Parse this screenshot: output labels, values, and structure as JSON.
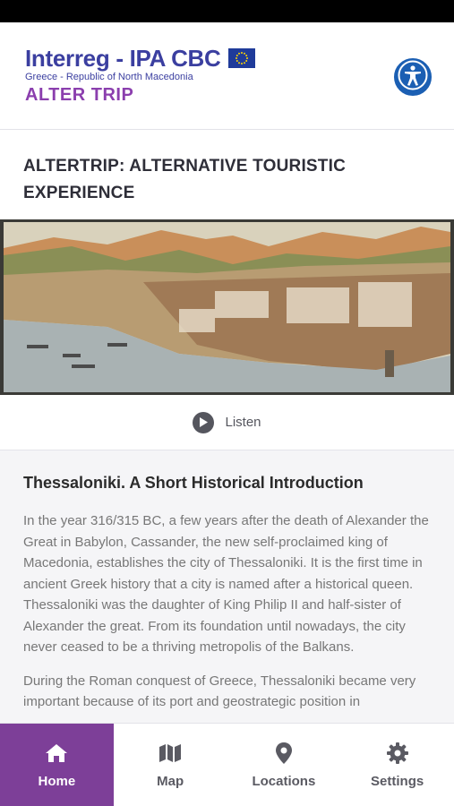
{
  "header": {
    "logo_main": "Interreg - IPA CBC",
    "logo_sub": "Greece - Republic of North Macedonia",
    "app_name": "ALTER TRIP"
  },
  "page": {
    "title": "ALTERTRIP: ALTERNATIVE TOURISTIC EXPERIENCE",
    "listen_label": "Listen"
  },
  "article": {
    "heading": "Thessaloniki. A Short Historical Introduction",
    "paragraphs": [
      "In the year 316/315 BC, a few years after the death of Alexander the Great in Babylon, Cassander, the new self-proclaimed king of Macedonia, establishes the city of Thessaloniki. It is the first time in ancient Greek history that a city is named after a historical queen. Thessaloniki was the daughter of King Philip II and half-sister of Alexander the great. From its foundation until nowadays, the city never ceased to be a thriving metropolis of the Balkans.",
      "During the Roman conquest of Greece, Thessaloniki became very important because of its port and geostrategic position in"
    ]
  },
  "tabs": [
    {
      "label": "Home",
      "icon": "home-icon",
      "active": true
    },
    {
      "label": "Map",
      "icon": "map-icon",
      "active": false
    },
    {
      "label": "Locations",
      "icon": "location-pin-icon",
      "active": false
    },
    {
      "label": "Settings",
      "icon": "gear-icon",
      "active": false
    }
  ],
  "colors": {
    "brand_blue": "#3b3fa0",
    "brand_purple": "#8b3fae",
    "active_tab": "#7d3f98",
    "accessibility_blue": "#1b5fb3"
  }
}
